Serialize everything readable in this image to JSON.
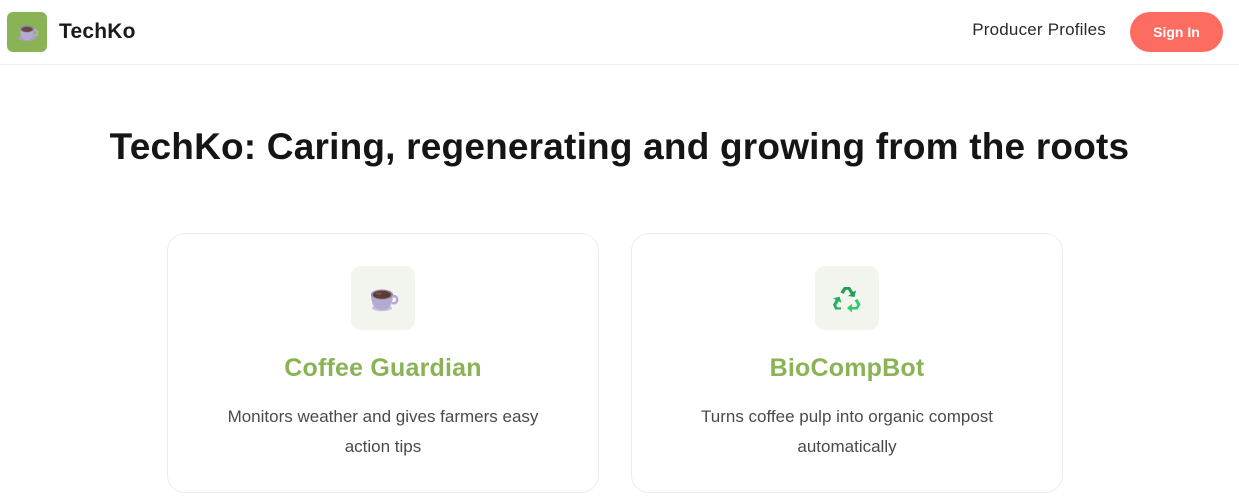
{
  "header": {
    "brand_name": "TechKo",
    "logo_icon": "coffee-cup-icon",
    "nav_producer_profiles": "Producer Profiles",
    "signin_label": "Sign In",
    "accent_color": "#fd6c61",
    "brand_color": "#8ab356"
  },
  "hero": {
    "title": "TechKo: Caring, regenerating and growing from the roots"
  },
  "cards": [
    {
      "icon": "coffee-cup-icon",
      "title": "Coffee Guardian",
      "description": "Monitors weather and gives farmers easy action tips"
    },
    {
      "icon": "recycle-icon",
      "title": "BioCompBot",
      "description": "Turns coffee pulp into organic compost automatically"
    }
  ]
}
